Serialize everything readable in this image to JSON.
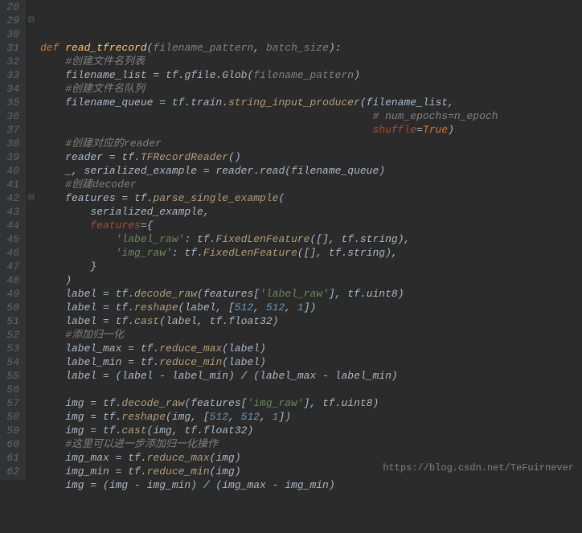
{
  "lines": {
    "28": {
      "gut": "28",
      "fold": "",
      "seg": [
        {
          "c": "var",
          "t": ""
        }
      ]
    },
    "29": {
      "gut": "29",
      "fold": "⊟",
      "seg": [
        {
          "c": "kw",
          "t": "def "
        },
        {
          "c": "fn",
          "t": "read_tfrecord"
        },
        {
          "c": "var",
          "t": "("
        },
        {
          "c": "par",
          "t": "filename_pattern"
        },
        {
          "c": "var",
          "t": ", "
        },
        {
          "c": "par",
          "t": "batch_size"
        },
        {
          "c": "var",
          "t": "):"
        }
      ]
    },
    "30": {
      "gut": "30",
      "fold": "",
      "seg": [
        {
          "c": "var",
          "t": "    "
        },
        {
          "c": "cm",
          "t": "#创建文件名列表"
        }
      ]
    },
    "31": {
      "gut": "31",
      "fold": "",
      "seg": [
        {
          "c": "var",
          "t": "    filename_list = tf.gfile.Glob("
        },
        {
          "c": "par",
          "t": "filename_pattern"
        },
        {
          "c": "var",
          "t": ")"
        }
      ]
    },
    "32": {
      "gut": "32",
      "fold": "",
      "seg": [
        {
          "c": "var",
          "t": "    "
        },
        {
          "c": "cm",
          "t": "#创建文件名队列"
        }
      ]
    },
    "33": {
      "gut": "33",
      "fold": "",
      "seg": [
        {
          "c": "var",
          "t": "    filename_queue = tf.train."
        },
        {
          "c": "call",
          "t": "string_input_producer"
        },
        {
          "c": "var",
          "t": "(filename_list,"
        }
      ]
    },
    "34": {
      "gut": "34",
      "fold": "",
      "seg": [
        {
          "c": "var",
          "t": "                                                     "
        },
        {
          "c": "cm",
          "t": "# num_epochs=n_epoch"
        }
      ]
    },
    "35": {
      "gut": "35",
      "fold": "",
      "seg": [
        {
          "c": "var",
          "t": "                                                     "
        },
        {
          "c": "attr",
          "t": "shuffle"
        },
        {
          "c": "var",
          "t": "="
        },
        {
          "c": "bool",
          "t": "True"
        },
        {
          "c": "var",
          "t": ")"
        }
      ]
    },
    "36": {
      "gut": "36",
      "fold": "",
      "seg": [
        {
          "c": "var",
          "t": "    "
        },
        {
          "c": "cm",
          "t": "#创建对应的reader"
        }
      ]
    },
    "37": {
      "gut": "37",
      "fold": "",
      "seg": [
        {
          "c": "var",
          "t": "    reader = tf."
        },
        {
          "c": "call",
          "t": "TFRecordReader"
        },
        {
          "c": "var",
          "t": "()"
        }
      ]
    },
    "38": {
      "gut": "38",
      "fold": "",
      "seg": [
        {
          "c": "var",
          "t": "    _, serialized_example = reader.read(filename_queue)"
        }
      ]
    },
    "39": {
      "gut": "39",
      "fold": "",
      "seg": [
        {
          "c": "var",
          "t": "    "
        },
        {
          "c": "cm",
          "t": "#创建decoder"
        }
      ]
    },
    "40": {
      "gut": "40",
      "fold": "",
      "seg": [
        {
          "c": "var",
          "t": "    features = tf."
        },
        {
          "c": "call",
          "t": "parse_single_example"
        },
        {
          "c": "var",
          "t": "("
        }
      ]
    },
    "41": {
      "gut": "41",
      "fold": "",
      "seg": [
        {
          "c": "var",
          "t": "        serialized_example,"
        }
      ]
    },
    "42": {
      "gut": "42",
      "fold": "⊟",
      "seg": [
        {
          "c": "var",
          "t": "        "
        },
        {
          "c": "attr",
          "t": "features"
        },
        {
          "c": "var",
          "t": "={"
        }
      ]
    },
    "43": {
      "gut": "43",
      "fold": "",
      "seg": [
        {
          "c": "var",
          "t": "            "
        },
        {
          "c": "str",
          "t": "'label_raw'"
        },
        {
          "c": "var",
          "t": ": tf."
        },
        {
          "c": "call",
          "t": "FixedLenFeature"
        },
        {
          "c": "var",
          "t": "([], tf.string),"
        }
      ]
    },
    "44": {
      "gut": "44",
      "fold": "",
      "seg": [
        {
          "c": "var",
          "t": "            "
        },
        {
          "c": "str",
          "t": "'img_raw'"
        },
        {
          "c": "var",
          "t": ": tf."
        },
        {
          "c": "call",
          "t": "FixedLenFeature"
        },
        {
          "c": "var",
          "t": "([], tf.string),"
        }
      ]
    },
    "45": {
      "gut": "45",
      "fold": "",
      "seg": [
        {
          "c": "var",
          "t": "        }"
        }
      ]
    },
    "46": {
      "gut": "46",
      "fold": "",
      "seg": [
        {
          "c": "var",
          "t": "    )"
        }
      ]
    },
    "47": {
      "gut": "47",
      "fold": "",
      "seg": [
        {
          "c": "var",
          "t": "    label = tf."
        },
        {
          "c": "call",
          "t": "decode_raw"
        },
        {
          "c": "var",
          "t": "(features["
        },
        {
          "c": "str",
          "t": "'label_raw'"
        },
        {
          "c": "var",
          "t": "], tf.uint8)"
        }
      ]
    },
    "48": {
      "gut": "48",
      "fold": "",
      "seg": [
        {
          "c": "var",
          "t": "    label = tf."
        },
        {
          "c": "call",
          "t": "reshape"
        },
        {
          "c": "var",
          "t": "(label, ["
        },
        {
          "c": "num",
          "t": "512"
        },
        {
          "c": "var",
          "t": ", "
        },
        {
          "c": "num",
          "t": "512"
        },
        {
          "c": "var",
          "t": ", "
        },
        {
          "c": "num",
          "t": "1"
        },
        {
          "c": "var",
          "t": "])"
        }
      ]
    },
    "49": {
      "gut": "49",
      "fold": "",
      "seg": [
        {
          "c": "var",
          "t": "    label = tf."
        },
        {
          "c": "call",
          "t": "cast"
        },
        {
          "c": "var",
          "t": "(label, tf.float32)"
        }
      ]
    },
    "50": {
      "gut": "50",
      "fold": "",
      "seg": [
        {
          "c": "var",
          "t": "    "
        },
        {
          "c": "cm",
          "t": "#添加归一化"
        }
      ]
    },
    "51": {
      "gut": "51",
      "fold": "",
      "seg": [
        {
          "c": "var",
          "t": "    label_max = tf."
        },
        {
          "c": "call",
          "t": "reduce_max"
        },
        {
          "c": "var",
          "t": "(label)"
        }
      ]
    },
    "52": {
      "gut": "52",
      "fold": "",
      "seg": [
        {
          "c": "var",
          "t": "    label_min = tf."
        },
        {
          "c": "call",
          "t": "reduce_min"
        },
        {
          "c": "var",
          "t": "(label)"
        }
      ]
    },
    "53": {
      "gut": "53",
      "fold": "",
      "seg": [
        {
          "c": "var",
          "t": "    label = (label - label_min) / (label_max - label_min)"
        }
      ]
    },
    "54": {
      "gut": "54",
      "fold": "",
      "seg": [
        {
          "c": "var",
          "t": ""
        }
      ]
    },
    "55": {
      "gut": "55",
      "fold": "",
      "seg": [
        {
          "c": "var",
          "t": "    img = tf."
        },
        {
          "c": "call",
          "t": "decode_raw"
        },
        {
          "c": "var",
          "t": "(features["
        },
        {
          "c": "str",
          "t": "'img_raw'"
        },
        {
          "c": "var",
          "t": "], tf.uint8)"
        }
      ]
    },
    "56": {
      "gut": "56",
      "fold": "",
      "seg": [
        {
          "c": "var",
          "t": "    img = tf."
        },
        {
          "c": "call",
          "t": "reshape"
        },
        {
          "c": "var",
          "t": "(img, ["
        },
        {
          "c": "num",
          "t": "512"
        },
        {
          "c": "var",
          "t": ", "
        },
        {
          "c": "num",
          "t": "512"
        },
        {
          "c": "var",
          "t": ", "
        },
        {
          "c": "num",
          "t": "1"
        },
        {
          "c": "var",
          "t": "])"
        }
      ]
    },
    "57": {
      "gut": "57",
      "fold": "",
      "seg": [
        {
          "c": "var",
          "t": "    img = tf."
        },
        {
          "c": "call",
          "t": "cast"
        },
        {
          "c": "var",
          "t": "(img, tf.float32)"
        }
      ]
    },
    "58": {
      "gut": "58",
      "fold": "",
      "seg": [
        {
          "c": "var",
          "t": "    "
        },
        {
          "c": "cm",
          "t": "#这里可以进一步添加归一化操作"
        }
      ]
    },
    "59": {
      "gut": "59",
      "fold": "",
      "seg": [
        {
          "c": "var",
          "t": "    img_max = tf."
        },
        {
          "c": "call",
          "t": "reduce_max"
        },
        {
          "c": "var",
          "t": "(img)"
        }
      ]
    },
    "60": {
      "gut": "60",
      "fold": "",
      "seg": [
        {
          "c": "var",
          "t": "    img_min = tf."
        },
        {
          "c": "call",
          "t": "reduce_min"
        },
        {
          "c": "var",
          "t": "(img)"
        }
      ]
    },
    "61": {
      "gut": "61",
      "fold": "",
      "seg": [
        {
          "c": "var",
          "t": "    img = (img - img_min) / (img_max - img_min)"
        }
      ]
    },
    "62": {
      "gut": "62",
      "fold": "",
      "seg": [
        {
          "c": "var",
          "t": ""
        }
      ]
    }
  },
  "watermark": "https://blog.csdn.net/TeFuirnever",
  "order": [
    "28",
    "29",
    "30",
    "31",
    "32",
    "33",
    "34",
    "35",
    "36",
    "37",
    "38",
    "39",
    "40",
    "41",
    "42",
    "43",
    "44",
    "45",
    "46",
    "47",
    "48",
    "49",
    "50",
    "51",
    "52",
    "53",
    "54",
    "55",
    "56",
    "57",
    "58",
    "59",
    "60",
    "61",
    "62"
  ]
}
